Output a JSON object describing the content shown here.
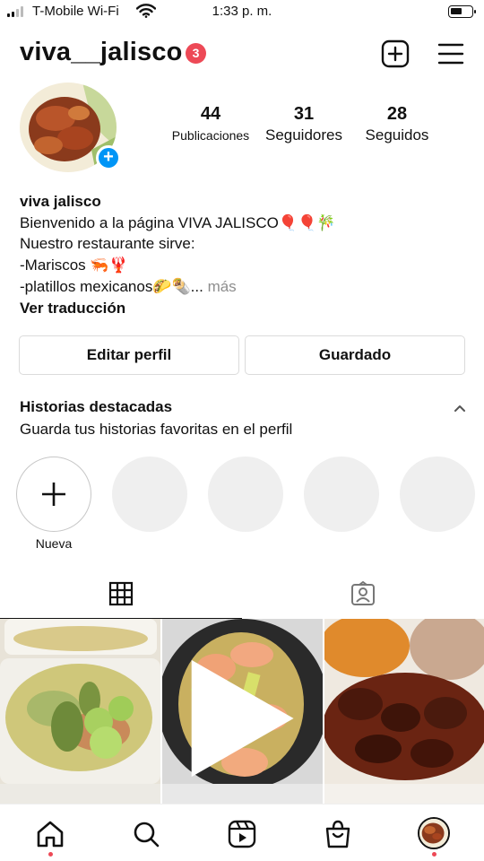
{
  "status_bar": {
    "carrier": "T-Mobile Wi-Fi",
    "time": "1:33 p. m."
  },
  "header": {
    "username": "viva__jalisco",
    "notification_count": "3"
  },
  "profile": {
    "stats": [
      {
        "value": "44",
        "label": "Publicaciones"
      },
      {
        "value": "31",
        "label": "Seguidores"
      },
      {
        "value": "28",
        "label": "Seguidos"
      }
    ],
    "add_story_symbol": "+"
  },
  "bio": {
    "name": "viva jalisco",
    "line1": "Bienvenido a la página VIVA JALISCO🎈🎈🎋",
    "line2": "Nuestro restaurante sirve:",
    "line3": "-Mariscos 🦐🦞",
    "line4": "-platillos mexicanos🌮🌯...",
    "more": " más",
    "translate": "Ver traducción"
  },
  "buttons": {
    "edit_profile": "Editar perfil",
    "saved": "Guardado"
  },
  "highlights": {
    "title": "Historias destacadas",
    "subtitle": "Guarda tus historias favoritas en el perfil",
    "new_label": "Nueva"
  },
  "tabs": {
    "active": "grid"
  },
  "bottom_nav": {
    "items": [
      "home",
      "search",
      "reels",
      "shop",
      "profile"
    ]
  },
  "colors": {
    "badge": "#ed4956",
    "accent_blue": "#0095f6",
    "border": "#dbdbdb",
    "placeholder": "#efefef",
    "muted_text": "#8e8e8e"
  }
}
